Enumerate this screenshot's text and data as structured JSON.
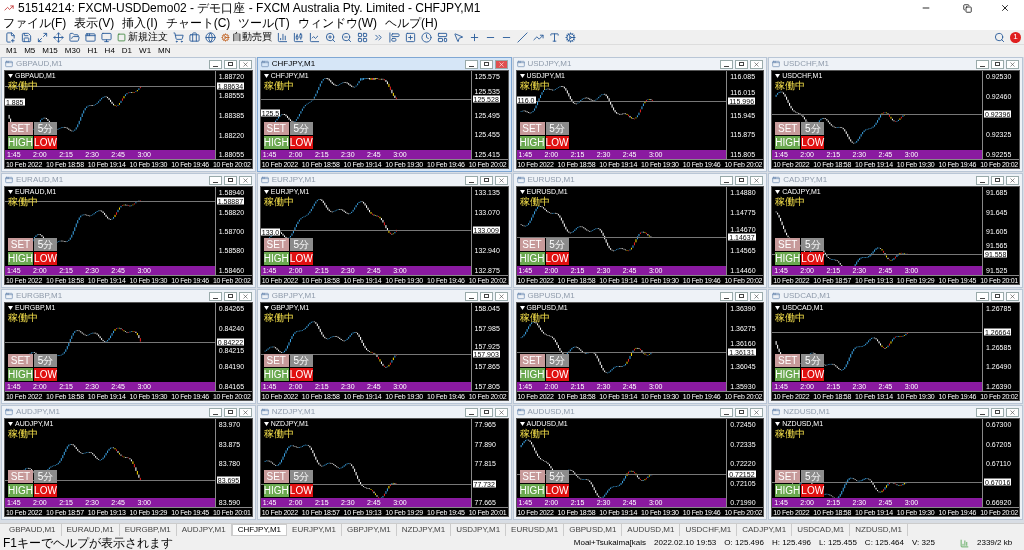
{
  "window": {
    "title": "51514214: FXCM-USDDemo02 - デモ口座 - FXCM Australia Pty. Limited - CHFJPY,M1"
  },
  "menu": [
    "ファイル(F)",
    "表示(V)",
    "挿入(I)",
    "チャート(C)",
    "ツール(T)",
    "ウィンドウ(W)",
    "ヘルプ(H)"
  ],
  "toolbar": {
    "new_order": "新規注文",
    "auto_trading": "自動売買",
    "notifications": "1"
  },
  "timeframes": [
    {
      "label": "M1",
      "selected": false
    },
    {
      "label": "M5",
      "selected": false
    },
    {
      "label": "M15",
      "selected": false
    },
    {
      "label": "M30",
      "selected": false
    },
    {
      "label": "H1",
      "selected": false
    },
    {
      "label": "H4",
      "selected": false
    },
    {
      "label": "D1",
      "selected": false
    },
    {
      "label": "W1",
      "selected": false
    },
    {
      "label": "MN",
      "selected": false
    }
  ],
  "charts": [
    {
      "title": "GBPAUD,M1",
      "active": false,
      "label": "GBPAUD,M1",
      "status": "稼働中",
      "buttons": [
        {
          "label": "SET",
          "kind": "set"
        },
        {
          "label": "5分",
          "kind": "period"
        },
        {
          "label": "HIGH",
          "kind": "high"
        },
        {
          "label": "LOW",
          "kind": "low"
        }
      ],
      "price_ticks": [
        "1.88720",
        "1.88555",
        "1.88385",
        "1.88220",
        "1.88055"
      ],
      "current_price": "1.88634",
      "left_label": "1.885",
      "session_times": [
        "1:45",
        "2:00",
        "2:15",
        "2:30",
        "2:45",
        "3:00"
      ],
      "dates": [
        "10 Feb 2022",
        "10 Feb 18:58",
        "10 Feb 19:14",
        "10 Feb 19:30",
        "10 Feb 19:46",
        "10 Feb 20:02"
      ]
    },
    {
      "title": "CHFJPY,M1",
      "active": true,
      "label": "CHFJPY,M1",
      "status": "稼働中",
      "buttons": [
        {
          "label": "SET",
          "kind": "set"
        },
        {
          "label": "5分",
          "kind": "period"
        },
        {
          "label": "HIGH",
          "kind": "high"
        },
        {
          "label": "LOW",
          "kind": "low"
        }
      ],
      "price_ticks": [
        "125.575",
        "125.535",
        "125.495",
        "125.455",
        "125.415"
      ],
      "current_price": "125.528",
      "left_label": "125.5",
      "session_times": [
        "1:45",
        "2:00",
        "2:15",
        "2:30",
        "2:45",
        "3:00"
      ],
      "dates": [
        "10 Feb 2022",
        "10 Feb 18:58",
        "10 Feb 19:14",
        "10 Feb 19:30",
        "10 Feb 19:46",
        "10 Feb 20:02"
      ]
    },
    {
      "title": "USDJPY,M1",
      "active": false,
      "label": "USDJPY,M1",
      "status": "稼働中",
      "buttons": [
        {
          "label": "SET",
          "kind": "set"
        },
        {
          "label": "5分",
          "kind": "period"
        },
        {
          "label": "HIGH",
          "kind": "high"
        },
        {
          "label": "LOW",
          "kind": "low"
        }
      ],
      "price_ticks": [
        "116.085",
        "116.015",
        "115.945",
        "115.875",
        "115.805"
      ],
      "current_price": "115.996",
      "left_label": "116.0",
      "session_times": [
        "1:45",
        "2:00",
        "2:15",
        "2:30",
        "2:45",
        "3:00"
      ],
      "dates": [
        "10 Feb 2022",
        "10 Feb 18:58",
        "10 Feb 19:14",
        "10 Feb 19:30",
        "10 Feb 19:46",
        "10 Feb 20:02"
      ]
    },
    {
      "title": "USDCHF,M1",
      "active": false,
      "label": "USDCHF,M1",
      "status": "稼働中",
      "buttons": [
        {
          "label": "SET",
          "kind": "set"
        },
        {
          "label": "5分",
          "kind": "period"
        },
        {
          "label": "HIGH",
          "kind": "high"
        },
        {
          "label": "LOW",
          "kind": "low"
        }
      ],
      "price_ticks": [
        "0.92530",
        "0.92460",
        "0.92325",
        "0.92255"
      ],
      "current_price": "0.92396",
      "session_times": [
        "1:45",
        "2:00",
        "2:15",
        "2:30",
        "2:45",
        "3:00"
      ],
      "dates": [
        "10 Feb 2022",
        "10 Feb 18:58",
        "10 Feb 19:14",
        "10 Feb 19:30",
        "10 Feb 19:46",
        "10 Feb 20:02"
      ]
    },
    {
      "title": "EURAUD,M1",
      "active": false,
      "label": "EURAUD,M1",
      "status": "稼働中",
      "buttons": [
        {
          "label": "SET",
          "kind": "set"
        },
        {
          "label": "5分",
          "kind": "period"
        },
        {
          "label": "HIGH",
          "kind": "high"
        },
        {
          "label": "LOW",
          "kind": "low"
        }
      ],
      "price_ticks": [
        "1.58940",
        "1.58820",
        "1.58700",
        "1.58580",
        "1.58460"
      ],
      "current_price": "1.58887",
      "session_times": [
        "1:45",
        "2:00",
        "2:15",
        "2:30",
        "2:45",
        "3:00"
      ],
      "dates": [
        "10 Feb 2022",
        "10 Feb 18:58",
        "10 Feb 19:14",
        "10 Feb 19:30",
        "10 Feb 19:46",
        "10 Feb 20:02"
      ]
    },
    {
      "title": "EURJPY,M1",
      "active": false,
      "label": "EURJPY,M1",
      "status": "稼働中",
      "buttons": [
        {
          "label": "SET",
          "kind": "set"
        },
        {
          "label": "5分",
          "kind": "period"
        },
        {
          "label": "HIGH",
          "kind": "high"
        },
        {
          "label": "LOW",
          "kind": "low"
        }
      ],
      "price_ticks": [
        "133.135",
        "133.070",
        "132.940",
        "132.875"
      ],
      "current_price": "133.009",
      "left_label": "133.0",
      "session_times": [
        "1:45",
        "2:00",
        "2:15",
        "2:30",
        "2:45",
        "3:00"
      ],
      "dates": [
        "10 Feb 2022",
        "10 Feb 18:58",
        "10 Feb 19:14",
        "10 Feb 19:30",
        "10 Feb 19:46",
        "10 Feb 20:02"
      ]
    },
    {
      "title": "EURUSD,M1",
      "active": false,
      "label": "EURUSD,M1",
      "status": "稼働中",
      "buttons": [
        {
          "label": "SET",
          "kind": "set"
        },
        {
          "label": "5分",
          "kind": "period"
        },
        {
          "label": "HIGH",
          "kind": "high"
        },
        {
          "label": "LOW",
          "kind": "low"
        }
      ],
      "price_ticks": [
        "1.14880",
        "1.14775",
        "1.14670",
        "1.14565",
        "1.14460"
      ],
      "current_price": "1.14637",
      "session_times": [
        "1:45",
        "2:00",
        "2:15",
        "2:30",
        "2:45",
        "3:00"
      ],
      "dates": [
        "10 Feb 2022",
        "10 Feb 18:58",
        "10 Feb 19:14",
        "10 Feb 19:30",
        "10 Feb 19:46",
        "10 Feb 20:02"
      ]
    },
    {
      "title": "CADJPY,M1",
      "active": false,
      "label": "CADJPY,M1",
      "status": "稼働中",
      "buttons": [
        {
          "label": "SET",
          "kind": "set"
        },
        {
          "label": "5分",
          "kind": "period"
        },
        {
          "label": "HIGH",
          "kind": "high"
        },
        {
          "label": "LOW",
          "kind": "low"
        }
      ],
      "price_ticks": [
        "91.685",
        "91.645",
        "91.605",
        "91.565",
        "91.525"
      ],
      "current_price": "91.558",
      "session_times": [
        "1:45",
        "2:00",
        "2:15",
        "2:30",
        "2:45",
        "3:00"
      ],
      "dates": [
        "10 Feb 2022",
        "10 Feb 18:57",
        "10 Feb 19:13",
        "10 Feb 19:29",
        "10 Feb 19:45",
        "10 Feb 20:01"
      ]
    },
    {
      "title": "EURGBP,M1",
      "active": false,
      "label": "EURGBP,M1",
      "status": "稼働中",
      "buttons": [
        {
          "label": "SET",
          "kind": "set"
        },
        {
          "label": "5分",
          "kind": "period"
        },
        {
          "label": "HIGH",
          "kind": "high"
        },
        {
          "label": "LOW",
          "kind": "low"
        }
      ],
      "price_ticks": [
        "0.84265",
        "0.84240",
        "0.84215",
        "0.84190",
        "0.84165"
      ],
      "current_price": "0.84222",
      "session_times": [
        "1:45",
        "2:00",
        "2:15",
        "2:30",
        "2:45",
        "3:00"
      ],
      "dates": [
        "10 Feb 2022",
        "10 Feb 18:58",
        "10 Feb 19:14",
        "10 Feb 19:30",
        "10 Feb 19:46",
        "10 Feb 20:02"
      ]
    },
    {
      "title": "GBPJPY,M1",
      "active": false,
      "label": "GBPJPY,M1",
      "status": "稼働中",
      "buttons": [
        {
          "label": "SET",
          "kind": "set"
        },
        {
          "label": "5分",
          "kind": "period"
        },
        {
          "label": "HIGH",
          "kind": "high"
        },
        {
          "label": "LOW",
          "kind": "low"
        }
      ],
      "price_ticks": [
        "158.045",
        "157.985",
        "157.925",
        "157.865",
        "157.805"
      ],
      "current_price": "157.903",
      "session_times": [
        "1:45",
        "2:00",
        "2:15",
        "2:30",
        "2:45",
        "3:00"
      ],
      "dates": [
        "10 Feb 2022",
        "10 Feb 18:58",
        "10 Feb 19:14",
        "10 Feb 19:30",
        "10 Feb 19:46",
        "10 Feb 20:02"
      ]
    },
    {
      "title": "GBPUSD,M1",
      "active": false,
      "label": "GBPUSD,M1",
      "status": "稼働中",
      "buttons": [
        {
          "label": "SET",
          "kind": "set"
        },
        {
          "label": "5分",
          "kind": "period"
        },
        {
          "label": "HIGH",
          "kind": "high"
        },
        {
          "label": "LOW",
          "kind": "low"
        }
      ],
      "price_ticks": [
        "1.36390",
        "1.36275",
        "1.36160",
        "1.36045",
        "1.35930"
      ],
      "current_price": "1.36131",
      "session_times": [
        "1:45",
        "2:00",
        "2:15",
        "2:30",
        "2:45",
        "3:00"
      ],
      "dates": [
        "10 Feb 2022",
        "10 Feb 18:58",
        "10 Feb 19:14",
        "10 Feb 19:30",
        "10 Feb 19:46",
        "10 Feb 20:02"
      ]
    },
    {
      "title": "USDCAD,M1",
      "active": false,
      "label": "USDCAD,M1",
      "status": "稼働中",
      "buttons": [
        {
          "label": "SET",
          "kind": "set"
        },
        {
          "label": "5分",
          "kind": "period"
        },
        {
          "label": "HIGH",
          "kind": "high"
        },
        {
          "label": "LOW",
          "kind": "low"
        }
      ],
      "price_ticks": [
        "1.26785",
        "1.26585",
        "1.26490",
        "1.26390"
      ],
      "current_price": "1.26664",
      "session_times": [
        "1:45",
        "2:00",
        "2:15",
        "2:30",
        "2:45",
        "3:00"
      ],
      "dates": [
        "10 Feb 2022",
        "10 Feb 18:58",
        "10 Feb 19:14",
        "10 Feb 19:30",
        "10 Feb 19:46",
        "10 Feb 20:02"
      ]
    },
    {
      "title": "AUDJPY,M1",
      "active": false,
      "label": "AUDJPY,M1",
      "status": "稼働中",
      "buttons": [
        {
          "label": "SET",
          "kind": "set"
        },
        {
          "label": "5分",
          "kind": "period"
        },
        {
          "label": "HIGH",
          "kind": "high"
        },
        {
          "label": "LOW",
          "kind": "low"
        }
      ],
      "price_ticks": [
        "83.970",
        "83.875",
        "83.780",
        "83.590"
      ],
      "current_price": "83.695",
      "session_times": [
        "1:45",
        "2:00",
        "2:15",
        "2:30",
        "2:45",
        "3:00"
      ],
      "dates": [
        "10 Feb 2022",
        "10 Feb 18:57",
        "10 Feb 19:13",
        "10 Feb 19:29",
        "10 Feb 19:45",
        "10 Feb 20:01"
      ]
    },
    {
      "title": "NZDJPY,M1",
      "active": false,
      "label": "NZDJPY,M1",
      "status": "稼働中",
      "buttons": [
        {
          "label": "SET",
          "kind": "set"
        },
        {
          "label": "5分",
          "kind": "period"
        },
        {
          "label": "HIGH",
          "kind": "high"
        },
        {
          "label": "LOW",
          "kind": "low"
        }
      ],
      "price_ticks": [
        "77.965",
        "77.890",
        "77.815",
        "77.665"
      ],
      "current_price": "77.732",
      "session_times": [
        "1:45",
        "2:00",
        "2:15",
        "2:30",
        "2:45",
        "3:00"
      ],
      "dates": [
        "10 Feb 2022",
        "10 Feb 18:57",
        "10 Feb 19:13",
        "10 Feb 19:29",
        "10 Feb 19:45",
        "10 Feb 20:01"
      ]
    },
    {
      "title": "AUDUSD,M1",
      "active": false,
      "label": "AUDUSD,M1",
      "status": "稼働中",
      "buttons": [
        {
          "label": "SET",
          "kind": "set"
        },
        {
          "label": "5分",
          "kind": "period"
        },
        {
          "label": "HIGH",
          "kind": "high"
        },
        {
          "label": "LOW",
          "kind": "low"
        }
      ],
      "price_ticks": [
        "0.72450",
        "0.72335",
        "0.72220",
        "0.72105",
        "0.71990"
      ],
      "current_price": "0.72152",
      "session_times": [
        "1:45",
        "2:00",
        "2:15",
        "2:30",
        "2:45",
        "3:00"
      ],
      "dates": [
        "10 Feb 2022",
        "10 Feb 18:58",
        "10 Feb 19:14",
        "10 Feb 19:30",
        "10 Feb 19:46",
        "10 Feb 20:02"
      ]
    },
    {
      "title": "NZDUSD,M1",
      "active": false,
      "label": "NZDUSD,M1",
      "status": "稼働中",
      "buttons": [
        {
          "label": "SET",
          "kind": "set"
        },
        {
          "label": "5分",
          "kind": "period"
        },
        {
          "label": "HIGH",
          "kind": "high"
        },
        {
          "label": "LOW",
          "kind": "low"
        }
      ],
      "price_ticks": [
        "0.67300",
        "0.67205",
        "0.67110",
        "0.66920"
      ],
      "current_price": "0.67016",
      "session_times": [
        "1:45",
        "2:00",
        "2:15",
        "2:30",
        "2:45",
        "3:00"
      ],
      "dates": [
        "10 Feb 2022",
        "10 Feb 18:58",
        "10 Feb 19:14",
        "10 Feb 19:30",
        "10 Feb 19:46",
        "10 Feb 20:02"
      ]
    }
  ],
  "chart_tabs": [
    {
      "label": "GBPAUD,M1",
      "selected": false
    },
    {
      "label": "EURAUD,M1",
      "selected": false
    },
    {
      "label": "EURGBP,M1",
      "selected": false
    },
    {
      "label": "AUDJPY,M1",
      "selected": false
    },
    {
      "label": "CHFJPY,M1",
      "selected": true
    },
    {
      "label": "EURJPY,M1",
      "selected": false
    },
    {
      "label": "GBPJPY,M1",
      "selected": false
    },
    {
      "label": "NZDJPY,M1",
      "selected": false
    },
    {
      "label": "USDJPY,M1",
      "selected": false
    },
    {
      "label": "EURUSD,M1",
      "selected": false
    },
    {
      "label": "GBPUSD,M1",
      "selected": false
    },
    {
      "label": "AUDUSD,M1",
      "selected": false
    },
    {
      "label": "USDCHF,M1",
      "selected": false
    },
    {
      "label": "CADJPY,M1",
      "selected": false
    },
    {
      "label": "USDCAD,M1",
      "selected": false
    },
    {
      "label": "NZDUSD,M1",
      "selected": false
    }
  ],
  "status_bar": {
    "help": "F1キーでヘルプが表示されます",
    "profile": "Moai+Tsukaima[kais",
    "datetime": "2022.02.10 19:53",
    "open": "O: 125.496",
    "high": "H: 125.496",
    "low": "L: 125.455",
    "close": "C: 125.464",
    "volume": "V: 325",
    "traffic": "2339/2 kb"
  }
}
